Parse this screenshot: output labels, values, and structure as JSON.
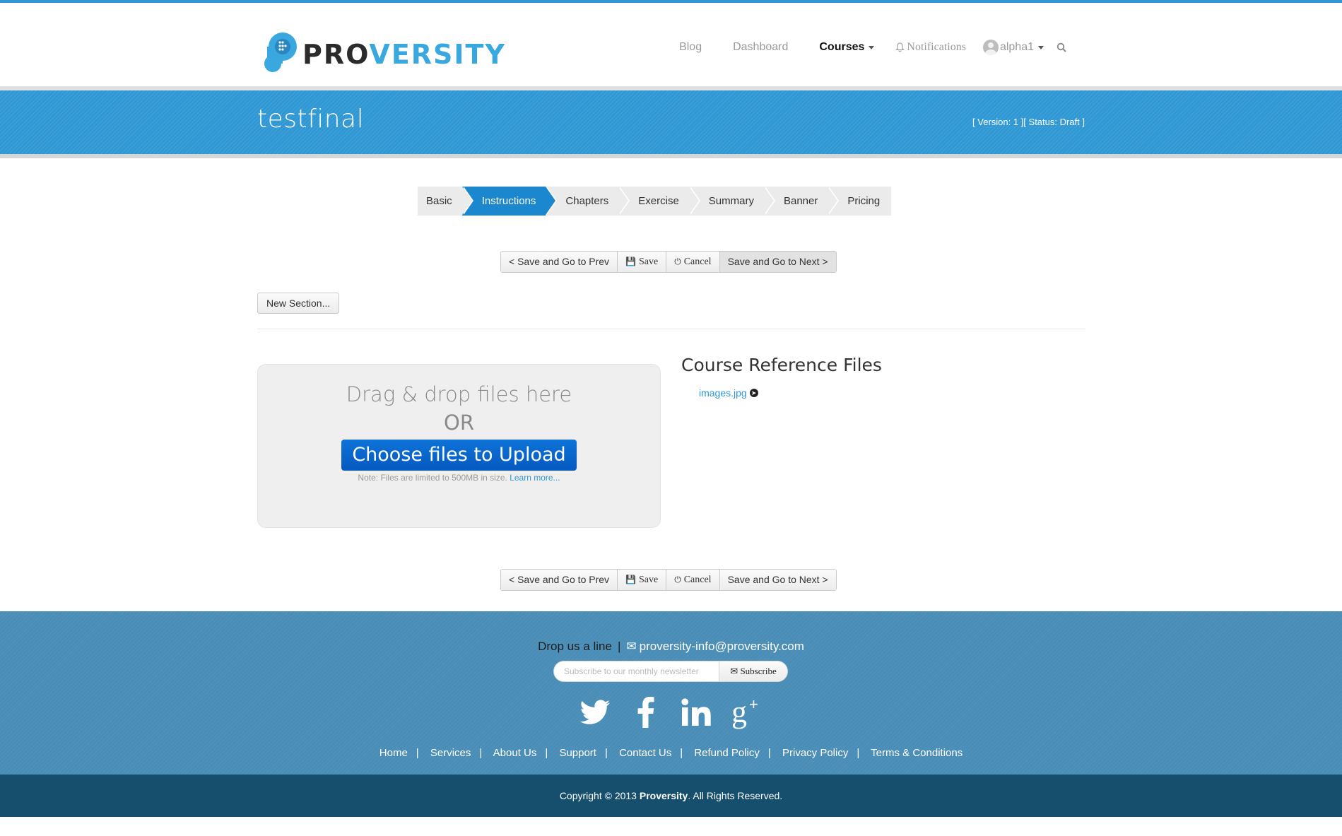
{
  "brand": {
    "part1": "PRO",
    "part2": "VERSITY"
  },
  "nav": {
    "blog": "Blog",
    "dashboard": "Dashboard",
    "courses": "Courses",
    "notifications": "Notifications",
    "user": "alpha1"
  },
  "course": {
    "title": "testfinal",
    "meta": "[ Version: 1 ][ Status: Draft ]"
  },
  "steps": [
    "Basic",
    "Instructions",
    "Chapters",
    "Exercise",
    "Summary",
    "Banner",
    "Pricing"
  ],
  "active_step": "Instructions",
  "actions": {
    "prev": "< Save and Go to Prev",
    "save": "Save",
    "cancel": "Cancel",
    "next": "Save and Go to Next >"
  },
  "new_section": "New Section...",
  "upload": {
    "drag": "Drag & drop files here",
    "or": "OR",
    "choose": "Choose files to Upload",
    "note": "Note: Files are limited to 500MB in size.",
    "learn": "Learn more..."
  },
  "reference": {
    "title": "Course Reference Files",
    "file": "images.jpg"
  },
  "footer": {
    "drop_label": "Drop us a line",
    "email": "proversity-info@proversity.com",
    "newsletter_placeholder": "Subscribe to our monthly newsletter",
    "subscribe": "Subscribe",
    "links": [
      "Home",
      "Services",
      "About Us",
      "Support",
      "Contact Us",
      "Refund Policy",
      "Privacy Policy",
      "Terms & Conditions"
    ],
    "copyright_pre": "Copyright © 2013",
    "copyright_brand": "Proversity",
    "copyright_post": ". All Rights Reserved."
  },
  "colors": {
    "accent": "#2f97d3",
    "active_step": "#1a87cf",
    "footer": "#4a8eb7",
    "copy_bar": "#164f6e",
    "upload_button": "#0659bf"
  },
  "icons": [
    "logo-icon",
    "bell-icon",
    "avatar-icon",
    "search-icon",
    "save-icon",
    "power-icon",
    "arrow-circle-right-icon",
    "envelope-icon",
    "twitter-icon",
    "facebook-icon",
    "linkedin-icon",
    "google-plus-icon"
  ]
}
